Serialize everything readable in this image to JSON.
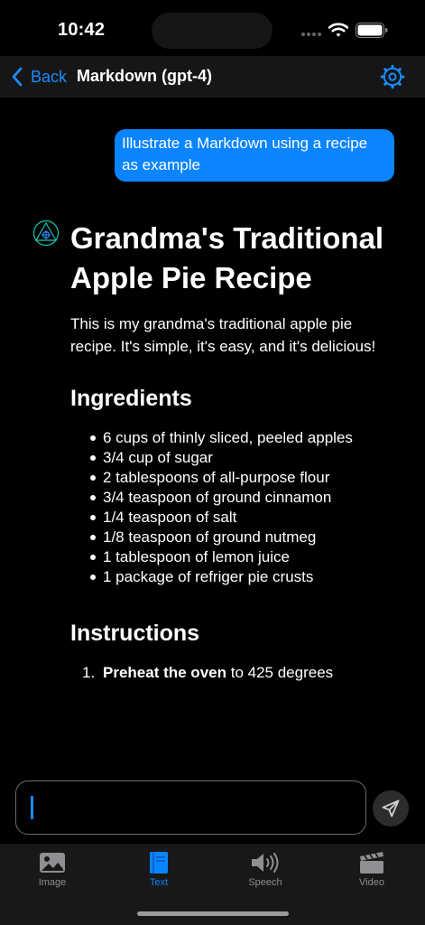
{
  "status_bar": {
    "time": "10:42"
  },
  "nav": {
    "back_label": "Back",
    "title": "Markdown (gpt-4)"
  },
  "chat": {
    "user_message": "Illustrate a Markdown using a recipe as example",
    "response": {
      "title": "Grandma's Traditional Apple Pie Recipe",
      "intro": "This is my grandma's traditional apple pie recipe. It's simple, it's easy, and it's delicious!",
      "ingredients_heading": "Ingredients",
      "ingredients": [
        "6 cups of thinly sliced, peeled apples",
        "3/4 cup of sugar",
        "2 tablespoons of all-purpose flour",
        "3/4 teaspoon of ground cinnamon",
        "1/4 teaspoon of salt",
        "1/8 teaspoon of ground nutmeg",
        "1 tablespoon of lemon juice",
        "1 package of refriger pie crusts"
      ],
      "instructions_heading": "Instructions",
      "instructions": [
        {
          "number": "1.",
          "bold": "Preheat the oven",
          "rest": " to 425 degrees"
        }
      ]
    }
  },
  "input": {
    "placeholder": ""
  },
  "tabs": [
    {
      "label": "Image",
      "icon": "image-icon",
      "active": false
    },
    {
      "label": "Text",
      "icon": "book-icon",
      "active": true
    },
    {
      "label": "Speech",
      "icon": "speaker-icon",
      "active": false
    },
    {
      "label": "Video",
      "icon": "clapperboard-icon",
      "active": false
    }
  ],
  "colors": {
    "accent": "#0a84ff",
    "background": "#000000",
    "bar": "#161616",
    "inactive": "#8e8e93"
  }
}
